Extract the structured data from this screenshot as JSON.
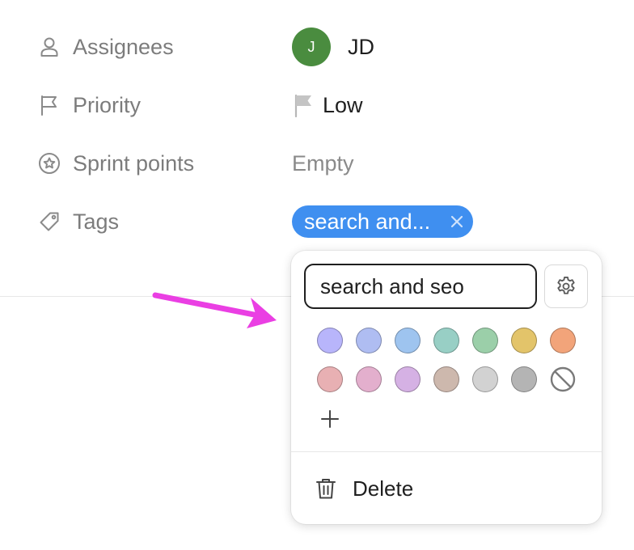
{
  "properties": {
    "assignees": {
      "label": "Assignees",
      "avatar_initial": "J",
      "value": "JD",
      "avatar_color": "#4a8c3f"
    },
    "priority": {
      "label": "Priority",
      "value": "Low"
    },
    "sprint_points": {
      "label": "Sprint points",
      "value": "Empty"
    },
    "tags": {
      "label": "Tags",
      "chip_text": "search and...",
      "chip_color": "#3f8ff0"
    }
  },
  "popover": {
    "input_value": "search and seo",
    "swatch_colors": [
      "#b8b5fb",
      "#afbdf2",
      "#9ec4ef",
      "#98cfc5",
      "#9bcfa9",
      "#e3c46a",
      "#f2a47a",
      "#e8b0b3",
      "#e3afcd",
      "#d5b1e4",
      "#cdb8ad",
      "#d2d2d2",
      "#b4b4b4"
    ],
    "delete_label": "Delete"
  },
  "annotation": {
    "arrow_color": "#ea3fe3"
  }
}
